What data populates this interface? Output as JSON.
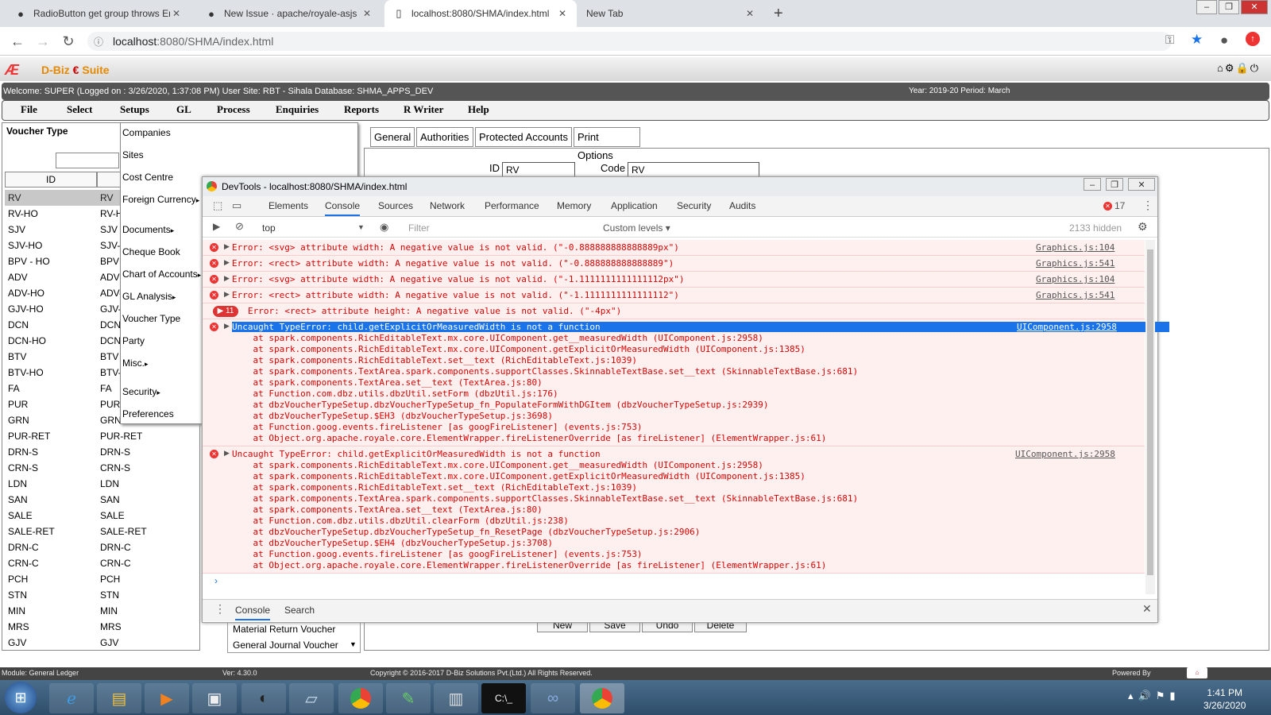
{
  "browser": {
    "tabs": [
      {
        "title": "RadioButton get group throws Er",
        "icon": "github-icon"
      },
      {
        "title": "New Issue · apache/royale-asjs",
        "icon": "github-icon"
      },
      {
        "title": "localhost:8080/SHMA/index.html",
        "icon": "page-icon"
      },
      {
        "title": "New Tab",
        "icon": ""
      }
    ],
    "url_host": "localhost",
    "url_path": ":8080/SHMA/index.html"
  },
  "app": {
    "logo_text": "D-Biz",
    "logo_suite": "Suite",
    "welcome": "Welcome: SUPER (Logged on : 3/26/2020, 1:37:08 PM) User Site: RBT - Sihala Database: SHMA_APPS_DEV",
    "year_period": "Year: 2019-20 Period: March",
    "menu": [
      "File",
      "Select",
      "Setups",
      "GL",
      "Process",
      "Enquiries",
      "Reports",
      "R Writer",
      "Help"
    ]
  },
  "left_panel": {
    "title": "Voucher Type",
    "col_id": "ID",
    "rows": [
      [
        "RV",
        "RV"
      ],
      [
        "RV-HO",
        "RV-H"
      ],
      [
        "SJV",
        "SJV"
      ],
      [
        "SJV-HO",
        "SJV-"
      ],
      [
        "BPV - HO",
        "BPV"
      ],
      [
        "ADV",
        "ADV"
      ],
      [
        "ADV-HO",
        "ADV-"
      ],
      [
        "GJV-HO",
        "GJV-"
      ],
      [
        "DCN",
        "DCN"
      ],
      [
        "DCN-HO",
        "DCN-"
      ],
      [
        "BTV",
        "BTV"
      ],
      [
        "BTV-HO",
        "BTV-"
      ],
      [
        "FA",
        "FA"
      ],
      [
        "PUR",
        "PUR"
      ],
      [
        "GRN",
        "GRN"
      ],
      [
        "PUR-RET",
        "PUR-RET"
      ],
      [
        "DRN-S",
        "DRN-S"
      ],
      [
        "CRN-S",
        "CRN-S"
      ],
      [
        "LDN",
        "LDN"
      ],
      [
        "SAN",
        "SAN"
      ],
      [
        "SALE",
        "SALE"
      ],
      [
        "SALE-RET",
        "SALE-RET"
      ],
      [
        "DRN-C",
        "DRN-C"
      ],
      [
        "CRN-C",
        "CRN-C"
      ],
      [
        "PCH",
        "PCH"
      ],
      [
        "STN",
        "STN"
      ],
      [
        "MIN",
        "MIN"
      ],
      [
        "MRS",
        "MRS"
      ],
      [
        "GJV",
        "GJV"
      ]
    ],
    "row_desc_mrs": "Material Return Voucher",
    "row_desc_gjv": "General Journal Voucher"
  },
  "setups_menu": [
    "Companies",
    "Sites",
    "Cost Centre",
    "Foreign Currency",
    "Documents",
    "Cheque Book",
    "Chart of Accounts",
    "GL Analysis",
    "Voucher Type",
    "Party",
    "Misc.",
    "Security",
    "Preferences"
  ],
  "right_panel": {
    "tabs": [
      "General",
      "Authorities",
      "Protected Accounts",
      "Print Options"
    ],
    "id_label": "ID",
    "id_value": "RV",
    "code_label": "Code",
    "code_value": "RV",
    "buttons": [
      "New",
      "Save",
      "Undo",
      "Delete"
    ]
  },
  "devtools": {
    "title": "DevTools - localhost:8080/SHMA/index.html",
    "tabs": [
      "Elements",
      "Console",
      "Sources",
      "Network",
      "Performance",
      "Memory",
      "Application",
      "Security",
      "Audits"
    ],
    "error_count": "17",
    "context": "top",
    "filter_placeholder": "Filter",
    "levels": "Custom levels",
    "hidden": "2133 hidden",
    "entries": [
      {
        "msg": "Error: <svg> attribute width: A negative value is not valid. (\"-0.888888888888889px\")",
        "src": "Graphics.js:104"
      },
      {
        "msg": "Error: <rect> attribute width: A negative value is not valid. (\"-0.888888888888889\")",
        "src": "Graphics.js:541"
      },
      {
        "msg": "Error: <svg> attribute width: A negative value is not valid. (\"-1.1111111111111112px\")",
        "src": "Graphics.js:104"
      },
      {
        "msg": "Error: <rect> attribute width: A negative value is not valid. (\"-1.1111111111111112\")",
        "src": "Graphics.js:541"
      }
    ],
    "repeat_count": "11",
    "repeat_msg": "Error: <rect> attribute height: A negative value is not valid. (\"-4px\")",
    "type_error_1": {
      "msg": "Uncaught TypeError: child.getExplicitOrMeasuredWidth is not a function",
      "src": "UIComponent.js:2958",
      "stack": [
        "    at spark.components.RichEditableText.mx.core.UIComponent.get__measuredWidth (UIComponent.js:2958)",
        "    at spark.components.RichEditableText.mx.core.UIComponent.getExplicitOrMeasuredWidth (UIComponent.js:1385)",
        "    at spark.components.RichEditableText.set__text (RichEditableText.js:1039)",
        "    at spark.components.TextArea.spark.components.supportClasses.SkinnableTextBase.set__text (SkinnableTextBase.js:681)",
        "    at spark.components.TextArea.set__text (TextArea.js:80)",
        "    at Function.com.dbz.utils.dbzUtil.setForm (dbzUtil.js:176)",
        "    at dbzVoucherTypeSetup.dbzVoucherTypeSetup_fn_PopulateFormWithDGItem (dbzVoucherTypeSetup.js:2939)",
        "    at dbzVoucherTypeSetup.$EH3 (dbzVoucherTypeSetup.js:3698)",
        "    at Function.goog.events.fireListener [as googFireListener] (events.js:753)",
        "    at Object.org.apache.royale.core.ElementWrapper.fireListenerOverride [as fireListener] (ElementWrapper.js:61)"
      ]
    },
    "type_error_2": {
      "msg": "Uncaught TypeError: child.getExplicitOrMeasuredWidth is not a function",
      "src": "UIComponent.js:2958",
      "stack": [
        "    at spark.components.RichEditableText.mx.core.UIComponent.get__measuredWidth (UIComponent.js:2958)",
        "    at spark.components.RichEditableText.mx.core.UIComponent.getExplicitOrMeasuredWidth (UIComponent.js:1385)",
        "    at spark.components.RichEditableText.set__text (RichEditableText.js:1039)",
        "    at spark.components.TextArea.spark.components.supportClasses.SkinnableTextBase.set__text (SkinnableTextBase.js:681)",
        "    at spark.components.TextArea.set__text (TextArea.js:80)",
        "    at Function.com.dbz.utils.dbzUtil.clearForm (dbzUtil.js:238)",
        "    at dbzVoucherTypeSetup.dbzVoucherTypeSetup_fn_ResetPage (dbzVoucherTypeSetup.js:2906)",
        "    at dbzVoucherTypeSetup.$EH4 (dbzVoucherTypeSetup.js:3708)",
        "    at Function.goog.events.fireListener [as googFireListener] (events.js:753)",
        "    at Object.org.apache.royale.core.ElementWrapper.fireListenerOverride [as fireListener] (ElementWrapper.js:61)"
      ]
    },
    "bottom_tabs": [
      "Console",
      "Search"
    ]
  },
  "status": {
    "module": "Module: General Ledger",
    "version": "Ver: 4.30.0",
    "copyright": "Copyright © 2016-2017 D-Biz Solutions Pvt.(Ltd.) All Rights Reserved.",
    "powered": "Powered By"
  },
  "taskbar": {
    "time": "1:41 PM",
    "date": "3/26/2020"
  }
}
